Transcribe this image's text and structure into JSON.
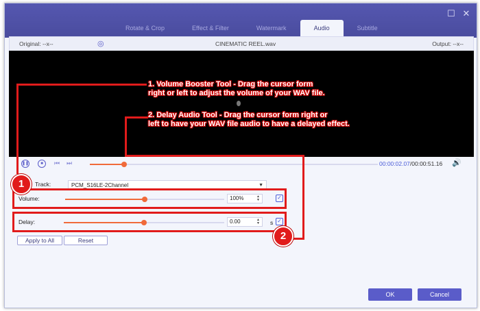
{
  "tabs": [
    {
      "label": "Rotate & Crop"
    },
    {
      "label": "Effect & Filter"
    },
    {
      "label": "Watermark"
    },
    {
      "label": "Audio"
    },
    {
      "label": "Subtitle"
    }
  ],
  "active_tab": "Audio",
  "infobar": {
    "original": "Original: --x--",
    "filename": "CINEMATIC REEL.wav",
    "output": "Output: --x--"
  },
  "playbar": {
    "progress": 0.12,
    "current_time": "00:00:02.07",
    "total_time": "/00:00:51.16"
  },
  "audio": {
    "track_label": "Track:",
    "track_value": "PCM_S16LE-2Channel",
    "volume_label": "Volume:",
    "volume_value": "100%",
    "volume_level": 0.5,
    "delay_label": "Delay:",
    "delay_value": "0.00",
    "delay_unit": "s",
    "delay_level": 0.5
  },
  "buttons": {
    "apply_to_all": "Apply to All",
    "reset": "Reset",
    "ok": "OK",
    "cancel": "Cancel"
  },
  "annotations": {
    "callout1_line1": "1. Volume Booster Tool - Drag the cursor form",
    "callout1_line2": "right or left to adjust the volume of your WAV file.",
    "callout2_line1": "2. Delay Audio Tool - Drag the cursor form right or",
    "callout2_line2": "left to have your WAV file audio to have a delayed effect.",
    "badge1": "1",
    "badge2": "2"
  },
  "colors": {
    "accent": "#5a5cc9",
    "slider": "#f06a3a",
    "annotation": "#e11b1b"
  }
}
